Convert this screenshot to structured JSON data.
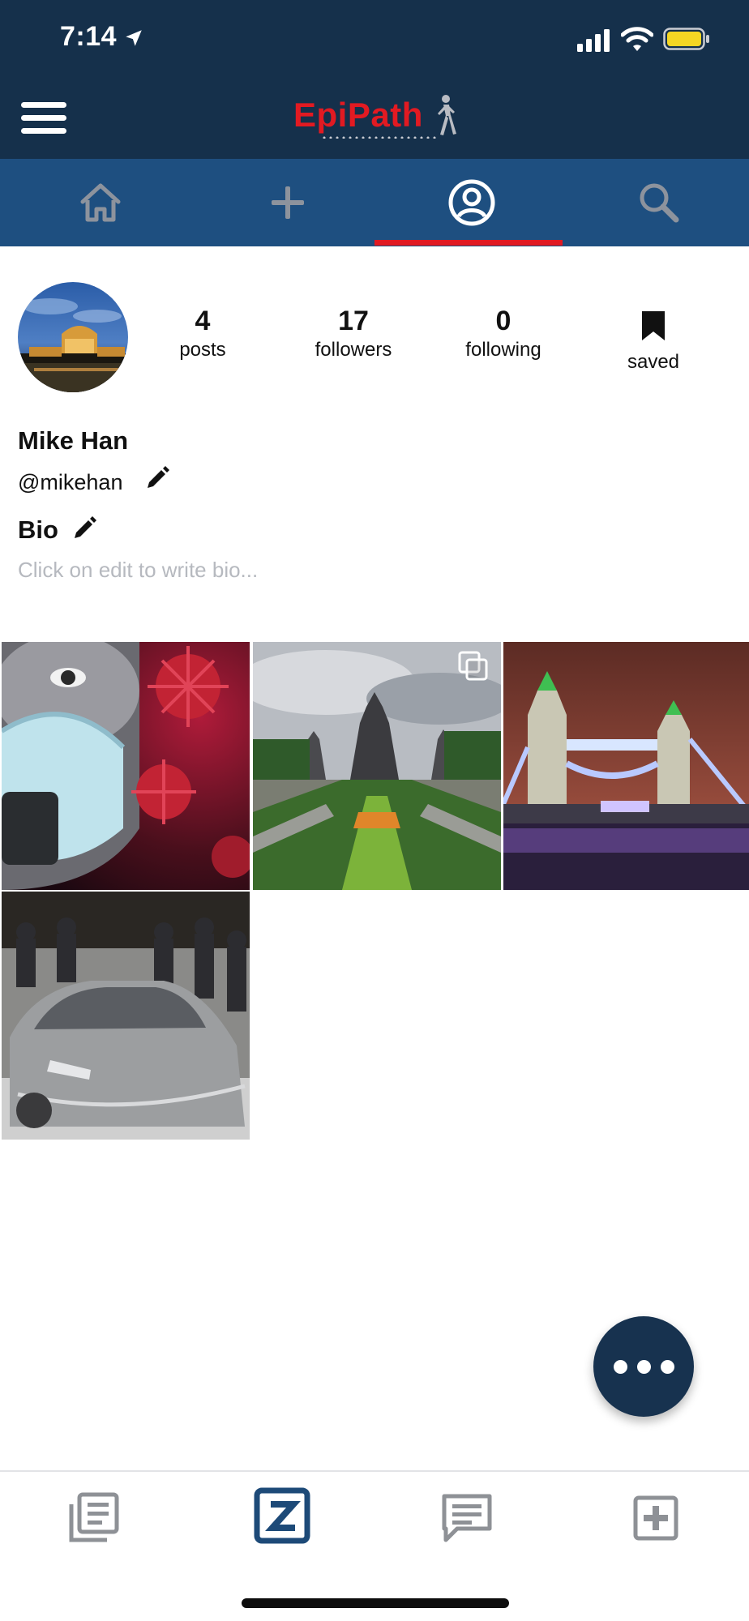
{
  "status_bar": {
    "time": "7:14"
  },
  "header": {
    "brand": "EpiPath"
  },
  "tabs": [
    {
      "name": "home",
      "active": false
    },
    {
      "name": "add",
      "active": false
    },
    {
      "name": "profile",
      "active": true
    },
    {
      "name": "search",
      "active": false
    }
  ],
  "profile": {
    "stats": {
      "posts": {
        "value": "4",
        "label": "posts"
      },
      "followers": {
        "value": "17",
        "label": "followers"
      },
      "following": {
        "value": "0",
        "label": "following"
      },
      "saved": {
        "label": "saved"
      }
    },
    "name": "Mike Han",
    "handle": "@mikehan",
    "bio_label": "Bio",
    "bio_placeholder": "Click on edit to write bio..."
  },
  "posts": [
    {
      "subject": "mask-virus",
      "multi": false
    },
    {
      "subject": "temple-garden",
      "multi": true
    },
    {
      "subject": "tower-bridge-night",
      "multi": false
    },
    {
      "subject": "silver-car",
      "multi": false
    }
  ],
  "bottom_nav": [
    {
      "icon": "feed-icon",
      "active": false
    },
    {
      "icon": "z-logo-icon",
      "active": true
    },
    {
      "icon": "chat-icon",
      "active": false
    },
    {
      "icon": "add-box-icon",
      "active": false
    }
  ],
  "colors": {
    "header_bg": "#15304b",
    "tabbar_bg": "#1e4f80",
    "accent_red": "#e11a22",
    "fab_bg": "#17324f",
    "active_nav": "#1d4a78",
    "inactive_nav": "#8e9196"
  }
}
